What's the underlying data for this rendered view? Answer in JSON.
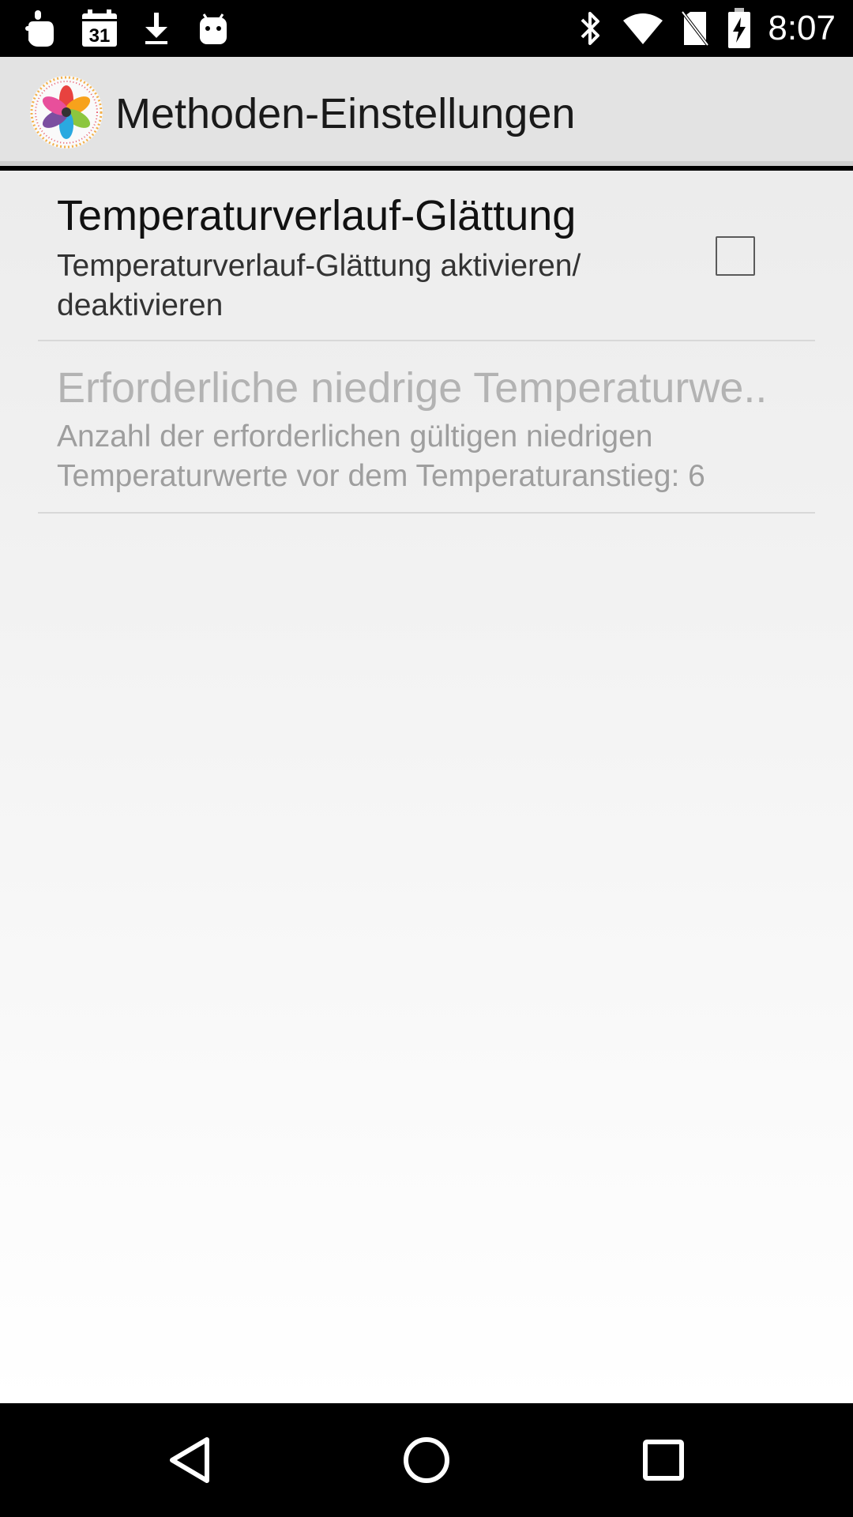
{
  "status_bar": {
    "time": "8:07",
    "calendar_day": "31",
    "left_icons": [
      "hand-notification-icon",
      "calendar-icon",
      "download-icon",
      "android-icon"
    ],
    "right_icons": [
      "bluetooth-icon",
      "wifi-icon",
      "no-sim-icon",
      "battery-charging-icon"
    ]
  },
  "app_bar": {
    "title": "Methoden-Einstellungen",
    "logo": "app-logo-flower-icon"
  },
  "preferences": [
    {
      "title": "Temperaturverlauf-Glättung",
      "summary": "Temperaturverlauf-Glättung aktivieren/ deaktivieren",
      "checked": false,
      "enabled": true
    },
    {
      "title": "Erforderliche niedrige Temperaturwe..",
      "summary": "Anzahl der erforderlichen gültigen niedrigen Temperaturwerte vor dem Temperaturanstieg: 6",
      "enabled": false
    }
  ],
  "nav_bar": {
    "buttons": [
      "back-icon",
      "home-icon",
      "recents-icon"
    ]
  }
}
